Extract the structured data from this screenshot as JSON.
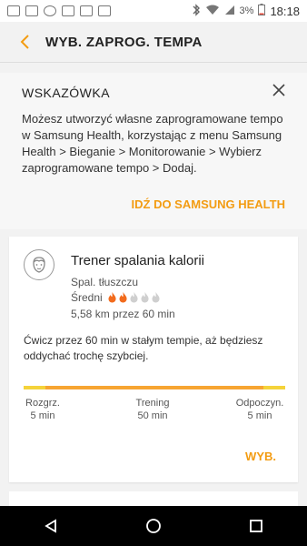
{
  "status_bar": {
    "battery": "3%",
    "time": "18:18"
  },
  "app_bar": {
    "title": "WYB. ZAPROG. TEMPA"
  },
  "tip": {
    "title": "WSKAZÓWKA",
    "body": "Możesz utworzyć własne zaprogramowane tempo w Samsung Health, korzystając z menu Samsung Health > Bieganie > Monitorowanie > Wybierz zaprogramowane tempo > Dodaj.",
    "link": "IDŹ DO SAMSUNG HEALTH"
  },
  "pace_card": {
    "title": "Trener spalania kalorii",
    "goal": "Spal. tłuszczu",
    "level_label": "Średni",
    "level_active": 2,
    "level_max": 5,
    "distance_time": "5,58 km przez 60 min",
    "description": "Ćwicz przez 60 min w stałym tempie, aż będziesz oddychać trochę szybciej.",
    "phases": [
      {
        "name": "Rozgrz.",
        "duration": "5 min"
      },
      {
        "name": "Trening",
        "duration": "50 min"
      },
      {
        "name": "Odpoczyn.",
        "duration": "5 min"
      }
    ],
    "select_label": "WYB."
  },
  "colors": {
    "accent": "#F39C12",
    "warmup": "#F5D33A",
    "training": "#F7A532",
    "flame_active": "#F26B1D",
    "flame_inactive": "#CFCFCF"
  }
}
